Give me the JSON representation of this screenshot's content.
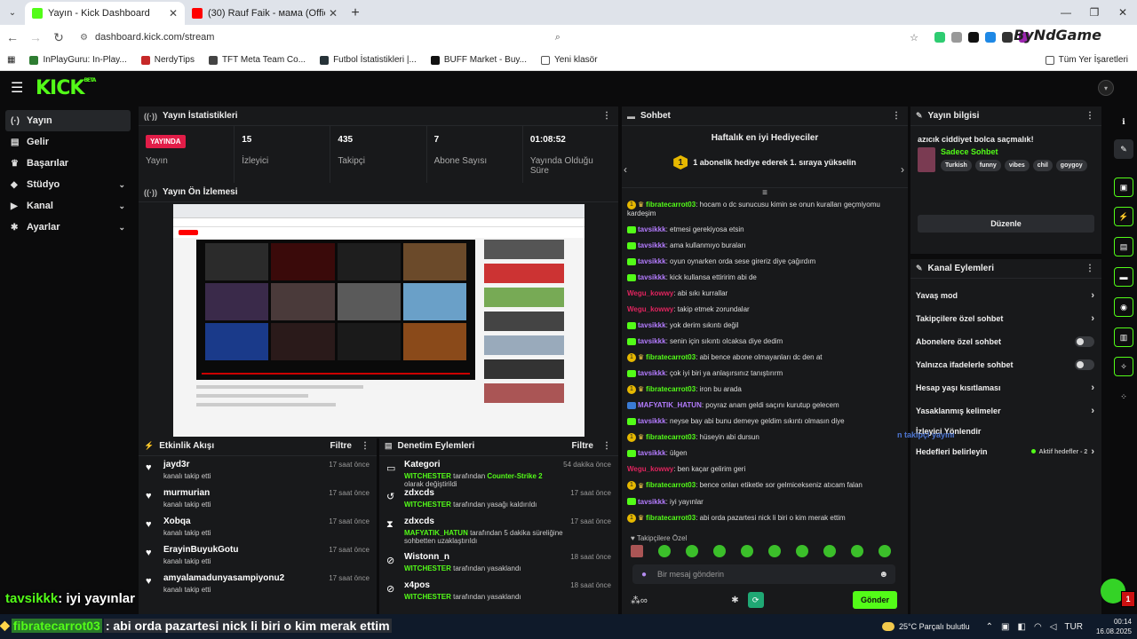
{
  "browser": {
    "tabs": [
      {
        "title": "Yayın - Kick Dashboard",
        "favicon_color": "#53fc18"
      },
      {
        "title": "(30) Rauf Faik - мама (Official a",
        "favicon_color": "#ff0000"
      }
    ],
    "url": "dashboard.kick.com/stream",
    "watermark": "ByNdGame",
    "bookmarks": [
      "InPlayGuru: In-Play...",
      "NerdyTips",
      "TFT Meta Team Co...",
      "Futbol İstatistikleri |...",
      "BUFF Market - Buy...",
      "Yeni klasör"
    ],
    "bookmarks_right": "Tüm Yer İşaretleri"
  },
  "app": {
    "logo": "KICK",
    "logo_sup": "BETA",
    "accent": "#53fc18"
  },
  "sidebar": {
    "items": [
      {
        "label": "Yayın",
        "icon": "broadcast-icon",
        "glyph": "(·)"
      },
      {
        "label": "Gelir",
        "icon": "wallet-icon",
        "glyph": "▤"
      },
      {
        "label": "Başarılar",
        "icon": "trophy-icon",
        "glyph": "♛"
      },
      {
        "label": "Stüdyo",
        "icon": "studio-icon",
        "glyph": "◆"
      },
      {
        "label": "Kanal",
        "icon": "channel-icon",
        "glyph": "▶"
      },
      {
        "label": "Ayarlar",
        "icon": "gear-icon",
        "glyph": "✱"
      }
    ]
  },
  "stats_panel": {
    "title": "Yayın İstatistikleri",
    "live_badge": "YAYINDA",
    "live_label": "Yayın",
    "stats": [
      {
        "value": "15",
        "label": "İzleyici"
      },
      {
        "value": "435",
        "label": "Takipçi"
      },
      {
        "value": "7",
        "label": "Abone Sayısı"
      },
      {
        "value": "01:08:52",
        "label": "Yayında Olduğu Süre"
      }
    ]
  },
  "preview_panel": {
    "title": "Yayın Ön İzlemesi"
  },
  "activity": {
    "title": "Etkinlik Akışı",
    "filter": "Filtre",
    "items": [
      {
        "name": "jayd3r",
        "sub": "kanalı takip etti",
        "time": "17 saat önce"
      },
      {
        "name": "murmurian",
        "sub": "kanalı takip etti",
        "time": "17 saat önce"
      },
      {
        "name": "Xobqa",
        "sub": "kanalı takip etti",
        "time": "17 saat önce"
      },
      {
        "name": "ErayinBuyukGotu",
        "sub": "kanalı takip etti",
        "time": "17 saat önce"
      },
      {
        "name": "amyalamadunyasampiyonu2",
        "sub": "kanalı takip etti",
        "time": "17 saat önce"
      }
    ]
  },
  "moderation": {
    "title": "Denetim Eylemleri",
    "filter": "Filtre",
    "items": [
      {
        "icon": "tv-icon",
        "glyph": "▭",
        "name": "Kategori",
        "time": "54 dakika önce",
        "actor": "WITCHESTER",
        "text1": " tarafından ",
        "target": "Counter-Strike 2",
        "text2": " olarak değiştirildi"
      },
      {
        "icon": "undo-icon",
        "glyph": "↺",
        "name": "zdxcds",
        "time": "17 saat önce",
        "actor": "WITCHESTER",
        "text1": " tarafından yasağı kaldırıldı",
        "target": "",
        "text2": ""
      },
      {
        "icon": "hourglass-icon",
        "glyph": "⧗",
        "name": "zdxcds",
        "time": "17 saat önce",
        "actor": "MAFYATIK_HATUN",
        "text1": " tarafından 5 dakika süreliğine sohbetten uzaklaştırıldı",
        "target": "",
        "text2": ""
      },
      {
        "icon": "ban-icon",
        "glyph": "⊘",
        "name": "Wistonn_n",
        "time": "18 saat önce",
        "actor": "WITCHESTER",
        "text1": " tarafından yasaklandı",
        "target": "",
        "text2": ""
      },
      {
        "icon": "ban-icon",
        "glyph": "⊘",
        "name": "x4pos",
        "time": "18 saat önce",
        "actor": "WITCHESTER",
        "text1": " tarafından yasaklandı",
        "target": "",
        "text2": ""
      }
    ]
  },
  "chat": {
    "title": "Sohbet",
    "gift_title": "Haftalık en iyi Hediyeciler",
    "gift_text": "1 abonelik hediye ederek 1. sıraya yükselin",
    "gift_rank": "1",
    "messages": [
      {
        "badge": "gift",
        "user": "fibratecarrot03",
        "color": "#53fc18",
        "text": ": hocam o dc sunucusu kimin se onun kuralları geçmiyomu kardeşim"
      },
      {
        "badge": "sub",
        "user": "tavsikkk",
        "color": "#b47cff",
        "text": ": etmesi gerekiyosa etsin"
      },
      {
        "badge": "sub",
        "user": "tavsikkk",
        "color": "#b47cff",
        "text": ": ama kullanmıyo buraları"
      },
      {
        "badge": "sub",
        "user": "tavsikkk",
        "color": "#b47cff",
        "text": ": oyun oynarken orda sese gireriz diye çağırdım"
      },
      {
        "badge": "sub",
        "user": "tavsikkk",
        "color": "#b47cff",
        "text": ": kick kullansa ettiririm abi de"
      },
      {
        "badge": "none",
        "user": "Wegu_kowwy",
        "color": "#e0245e",
        "text": ": abi sıkı kurrallar"
      },
      {
        "badge": "none",
        "user": "Wegu_kowwy",
        "color": "#e0245e",
        "text": ": takip etmek zorundalar"
      },
      {
        "badge": "sub",
        "user": "tavsikkk",
        "color": "#b47cff",
        "text": ": yok derim sıkıntı değil"
      },
      {
        "badge": "sub",
        "user": "tavsikkk",
        "color": "#b47cff",
        "text": ": senin için sıkıntı olcaksa diye dedim"
      },
      {
        "badge": "gift",
        "user": "fibratecarrot03",
        "color": "#53fc18",
        "text": ": abi bence abone olmayanları dc den at"
      },
      {
        "badge": "sub",
        "user": "tavsikkk",
        "color": "#b47cff",
        "text": ": çok iyi biri ya anlaşırsınız tanıştırırm"
      },
      {
        "badge": "gift",
        "user": "fibratecarrot03",
        "color": "#53fc18",
        "text": ": iron bu arada"
      },
      {
        "badge": "mod",
        "user": "MAFYATIK_HATUN",
        "color": "#b47cff",
        "text": ": poyraz anam geldi saçını kurutup gelecem"
      },
      {
        "badge": "sub",
        "user": "tavsikkk",
        "color": "#b47cff",
        "text": ": neyse bay abi bunu demeye geldim sıkıntı olmasın diye"
      },
      {
        "badge": "gift",
        "user": "fibratecarrot03",
        "color": "#53fc18",
        "text": ": hüseyin abi dursun"
      },
      {
        "badge": "sub",
        "user": "tavsikkk",
        "color": "#b47cff",
        "text": ": ülgen"
      },
      {
        "badge": "none",
        "user": "Wegu_kowwy",
        "color": "#e0245e",
        "text": ": ben kaçar gelirim geri"
      },
      {
        "badge": "gift",
        "user": "fibratecarrot03",
        "color": "#53fc18",
        "text": ": bence onları etiketle sor gelmicekseniz atıcam falan"
      },
      {
        "badge": "sub",
        "user": "tavsikkk",
        "color": "#b47cff",
        "text": ": iyi yayınlar"
      },
      {
        "badge": "gift",
        "user": "fibratecarrot03",
        "color": "#53fc18",
        "text": ": abi orda pazartesi nick li biri o kim merak ettim"
      }
    ],
    "favorites_label": "♥ Takipçilere Özel",
    "input_placeholder": "Bir mesaj gönderin",
    "send_label": "Gönder"
  },
  "stream_info": {
    "title": "Yayın bilgisi",
    "stream_title": "azıcık ciddiyet bolca saçmalık!",
    "category": "Sadece Sohbet",
    "tags": [
      "Turkish",
      "funny",
      "vibes",
      "chil",
      "goygoy"
    ],
    "edit_label": "Düzenle"
  },
  "channel_actions": {
    "title": "Kanal Eylemleri",
    "items": [
      {
        "label": "Yavaş mod",
        "type": "chevron"
      },
      {
        "label": "Takipçilere özel sohbet",
        "type": "chevron"
      },
      {
        "label": "Abonelere özel sohbet",
        "type": "toggle"
      },
      {
        "label": "Yalnızca ifadelerle sohbet",
        "type": "toggle"
      },
      {
        "label": "Hesap yaşı kısıtlaması",
        "type": "chevron"
      },
      {
        "label": "Yasaklanmış kelimeler",
        "type": "chevron"
      },
      {
        "label": "İzleyici Yönlendir",
        "type": "none"
      },
      {
        "label": "Hedefleri belirleyin",
        "type": "chevron",
        "extra": "Aktif hedefler - 2"
      }
    ]
  },
  "overlays": {
    "floating_chat_user": "tavsikkk",
    "floating_chat_text": ": iyi yayınlar",
    "ticker_user": "fibratecarrot03",
    "ticker_text": ": abi orda pazartesi nick li biri o kim merak ettim",
    "ghost_text": "n takipçi yayını"
  },
  "taskbar": {
    "weather": "25°C  Parçalı bulutlu",
    "lang": "TUR",
    "time": "00:14",
    "date": "16.08.2025"
  }
}
